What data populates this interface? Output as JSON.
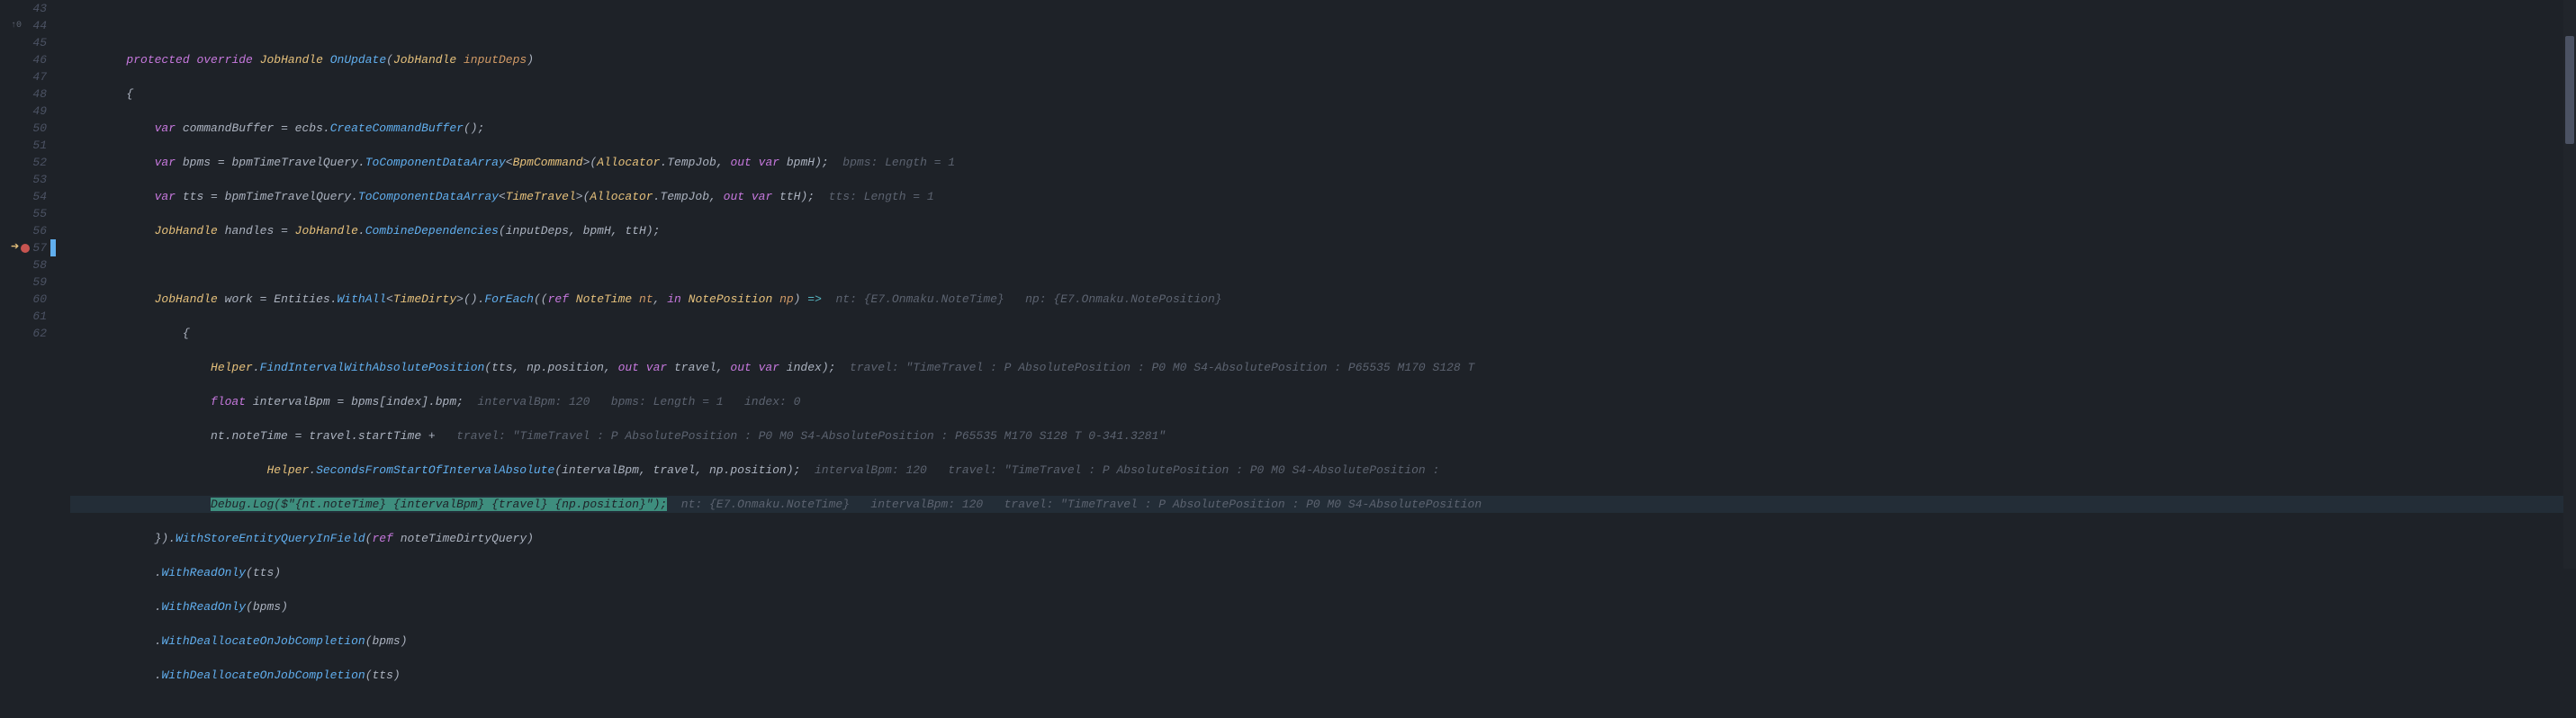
{
  "line_numbers": [
    "43",
    "44",
    "45",
    "46",
    "47",
    "48",
    "49",
    "50",
    "51",
    "52",
    "53",
    "54",
    "55",
    "56",
    "57",
    "58",
    "59",
    "60",
    "61",
    "62"
  ],
  "gutter": {
    "ref_marker": {
      "line": "44",
      "text": "↑0"
    },
    "breakpoint_line": "57",
    "execution_line": "57"
  },
  "code": {
    "l44": {
      "kw1": "protected",
      "kw2": "override",
      "type": "JobHandle",
      "method": "OnUpdate",
      "paren_open": "(",
      "param_type": "JobHandle",
      "param_name": "inputDeps",
      "paren_close": ")"
    },
    "l45": {
      "brace": "{"
    },
    "l46": {
      "kw": "var",
      "name": "commandBuffer",
      "eq": " = ",
      "obj": "ecbs",
      "dot": ".",
      "method": "CreateCommandBuffer",
      "call": "();"
    },
    "l47": {
      "kw": "var",
      "name": "bpms",
      "eq": " = ",
      "obj": "bpmTimeTravelQuery",
      "dot": ".",
      "method": "ToComponentDataArray",
      "lt": "<",
      "gtype": "BpmCommand",
      "gt": ">",
      "po": "(",
      "alloc": "Allocator",
      "adot": ".",
      "temp": "TempJob",
      "comma": ", ",
      "out": "out var",
      "ov": " bpmH",
      "pc": ");",
      "hint": "  bpms: Length = 1"
    },
    "l48": {
      "kw": "var",
      "name": "tts",
      "eq": " = ",
      "obj": "bpmTimeTravelQuery",
      "dot": ".",
      "method": "ToComponentDataArray",
      "lt": "<",
      "gtype": "TimeTravel",
      "gt": ">",
      "po": "(",
      "alloc": "Allocator",
      "adot": ".",
      "temp": "TempJob",
      "comma": ", ",
      "out": "out var",
      "ov": " ttH",
      "pc": ");",
      "hint": "  tts: Length = 1"
    },
    "l49": {
      "type": "JobHandle",
      "name": " handles",
      "eq": " = ",
      "type2": "JobHandle",
      "dot": ".",
      "method": "CombineDependencies",
      "po": "(",
      "args": "inputDeps, bpmH, ttH",
      "pc": ");"
    },
    "l51": {
      "type": "JobHandle",
      "name": " work",
      "eq": " = ",
      "obj": "Entities",
      "dot1": ".",
      "m1": "WithAll",
      "lt": "<",
      "gtype": "TimeDirty",
      "gt": ">",
      "call1": "()",
      "dot2": ".",
      "m2": "ForEach",
      "po": "((",
      "ref": "ref",
      "pt1": " NoteTime",
      "pn1": " nt",
      "c1": ", ",
      "in": "in",
      "pt2": " NotePosition",
      "pn2": " np",
      "pc": ") ",
      "arrow": "=>",
      "hint": "  nt: {E7.Onmaku.NoteTime}   np: {E7.Onmaku.NotePosition}"
    },
    "l52": {
      "brace": "{"
    },
    "l53": {
      "obj": "Helper",
      "dot": ".",
      "method": "FindIntervalWithAbsolutePosition",
      "po": "(",
      "a1": "tts, np",
      "d1": ".",
      "a1b": "position",
      "c1": ", ",
      "out1": "out var",
      "ov1": " travel",
      "c2": ", ",
      "out2": "out var",
      "ov2": " index",
      "pc": ");",
      "hint": "  travel: \"TimeTravel : P AbsolutePosition : P0 M0 S4-AbsolutePosition : P65535 M170 S128 T"
    },
    "l54": {
      "type": "float",
      "name": " intervalBpm",
      "eq": " = ",
      "obj": "bpms",
      "br": "[",
      "idx": "index",
      "br2": "].",
      "prop": "bpm",
      "sc": ";",
      "hint": "  intervalBpm: 120   bpms: Length = 1   index: 0"
    },
    "l55": {
      "obj": "nt",
      "dot": ".",
      "prop": "noteTime",
      "eq": " = ",
      "obj2": "travel",
      "dot2": ".",
      "prop2": "startTime",
      "plus": " +",
      "hint": "   travel: \"TimeTravel : P AbsolutePosition : P0 M0 S4-AbsolutePosition : P65535 M170 S128 T 0-341.3281\""
    },
    "l56": {
      "obj": "Helper",
      "dot": ".",
      "method": "SecondsFromStartOfIntervalAbsolute",
      "po": "(",
      "args": "intervalBpm, travel, np",
      "d1": ".",
      "a2": "position",
      "pc": ");",
      "hint": "  intervalBpm: 120   travel: \"TimeTravel : P AbsolutePosition : P0 M0 S4-AbsolutePosition :"
    },
    "l57": {
      "obj": "Debug",
      "dot": ".",
      "method": "Log",
      "po": "(",
      "dollar": "$",
      "str": "\"{nt.noteTime} {intervalBpm} {travel} {np.position}\"",
      "pc": ");",
      "hint": "  nt: {E7.Onmaku.NoteTime}   intervalBpm: 120   travel: \"TimeTravel : P AbsolutePosition : P0 M0 S4-AbsolutePosition"
    },
    "l58": {
      "close": "}).",
      "method": "WithStoreEntityQueryInField",
      "po": "(",
      "ref": "ref",
      "arg": " noteTimeDirtyQuery",
      "pc": ")"
    },
    "l59": {
      "dot": ".",
      "method": "WithReadOnly",
      "po": "(",
      "arg": "tts",
      "pc": ")"
    },
    "l60": {
      "dot": ".",
      "method": "WithReadOnly",
      "po": "(",
      "arg": "bpms",
      "pc": ")"
    },
    "l61": {
      "dot": ".",
      "method": "WithDeallocateOnJobCompletion",
      "po": "(",
      "arg": "bpms",
      "pc": ")"
    },
    "l62": {
      "dot": ".",
      "method": "WithDeallocateOnJobCompletion",
      "po": "(",
      "arg": "tts",
      "pc": ")"
    }
  },
  "indent": {
    "i0": "",
    "i2": "        ",
    "i3": "            ",
    "i4": "                ",
    "i5": "                    ",
    "i7": "                            "
  }
}
